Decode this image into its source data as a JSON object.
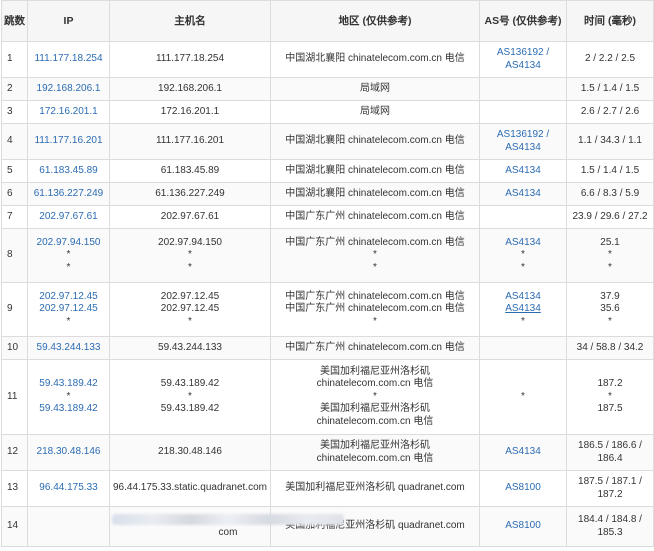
{
  "headers": {
    "hop": "跳数",
    "ip": "IP",
    "hostname": "主机名",
    "region": "地区 (仅供参考)",
    "asn": "AS号 (仅供参考)",
    "time": "时间 (毫秒)"
  },
  "rows": [
    {
      "hop": "1",
      "ip": [
        "111.177.18.254"
      ],
      "host": [
        "111.177.18.254"
      ],
      "region": [
        "中国湖北襄阳 chinatelecom.com.cn 电信"
      ],
      "asn": [
        "AS136192 /",
        "AS4134"
      ],
      "time": [
        "2 / 2.2 / 2.5"
      ]
    },
    {
      "hop": "2",
      "ip": [
        "192.168.206.1"
      ],
      "host": [
        "192.168.206.1"
      ],
      "region": [
        "局域网"
      ],
      "asn": [],
      "time": [
        "1.5 / 1.4 / 1.5"
      ]
    },
    {
      "hop": "3",
      "ip": [
        "172.16.201.1"
      ],
      "host": [
        "172.16.201.1"
      ],
      "region": [
        "局域网"
      ],
      "asn": [],
      "time": [
        "2.6 / 2.7 / 2.6"
      ]
    },
    {
      "hop": "4",
      "ip": [
        "111.177.16.201"
      ],
      "host": [
        "111.177.16.201"
      ],
      "region": [
        "中国湖北襄阳 chinatelecom.com.cn 电信"
      ],
      "asn": [
        "AS136192 /",
        "AS4134"
      ],
      "time": [
        "1.1 / 34.3 / 1.1"
      ]
    },
    {
      "hop": "5",
      "ip": [
        "61.183.45.89"
      ],
      "host": [
        "61.183.45.89"
      ],
      "region": [
        "中国湖北襄阳 chinatelecom.com.cn 电信"
      ],
      "asn": [
        "AS4134"
      ],
      "time": [
        "1.5 / 1.4 / 1.5"
      ]
    },
    {
      "hop": "6",
      "ip": [
        "61.136.227.249"
      ],
      "host": [
        "61.136.227.249"
      ],
      "region": [
        "中国湖北襄阳 chinatelecom.com.cn 电信"
      ],
      "asn": [
        "AS4134"
      ],
      "time": [
        "6.6 / 8.3 / 5.9"
      ]
    },
    {
      "hop": "7",
      "ip": [
        "202.97.67.61"
      ],
      "host": [
        "202.97.67.61"
      ],
      "region": [
        "中国广东广州 chinatelecom.com.cn 电信"
      ],
      "asn": [],
      "time": [
        "23.9 / 29.6 / 27.2"
      ]
    },
    {
      "hop": "8",
      "ip": [
        "202.97.94.150",
        "*",
        "*"
      ],
      "host": [
        "202.97.94.150",
        "*",
        "*"
      ],
      "region": [
        "中国广东广州 chinatelecom.com.cn 电信",
        "*",
        "*"
      ],
      "asn": [
        "AS4134",
        "*",
        "*"
      ],
      "time": [
        "25.1",
        "*",
        "*"
      ]
    },
    {
      "hop": "9",
      "ip": [
        "202.97.12.45",
        "202.97.12.45",
        "*"
      ],
      "host": [
        "202.97.12.45",
        "202.97.12.45",
        "*"
      ],
      "region": [
        "中国广东广州 chinatelecom.com.cn 电信",
        "中国广东广州 chinatelecom.com.cn 电信",
        "*"
      ],
      "asn": [
        "AS4134",
        "AS4134",
        "*"
      ],
      "time": [
        "37.9",
        "35.6",
        "*"
      ]
    },
    {
      "hop": "10",
      "ip": [
        "59.43.244.133"
      ],
      "host": [
        "59.43.244.133"
      ],
      "region": [
        "中国广东广州 chinatelecom.com.cn 电信"
      ],
      "asn": [],
      "time": [
        "34 / 58.8 / 34.2"
      ]
    },
    {
      "hop": "11",
      "ip": [
        "59.43.189.42",
        "*",
        "59.43.189.42"
      ],
      "host": [
        "59.43.189.42",
        "*",
        "59.43.189.42"
      ],
      "region": [
        "美国加利福尼亚州洛杉矶",
        "chinatelecom.com.cn 电信",
        "*",
        "美国加利福尼亚州洛杉矶",
        "chinatelecom.com.cn 电信"
      ],
      "asn": [
        "*"
      ],
      "time": [
        "187.2",
        "*",
        "187.5"
      ]
    },
    {
      "hop": "12",
      "ip": [
        "218.30.48.146"
      ],
      "host": [
        "218.30.48.146"
      ],
      "region": [
        "美国加利福尼亚州洛杉矶",
        "chinatelecom.com.cn 电信"
      ],
      "asn": [
        "AS4134"
      ],
      "time": [
        "186.5 / 186.6 /",
        "186.4"
      ]
    },
    {
      "hop": "13",
      "ip": [
        "96.44.175.33"
      ],
      "host": [
        "96.44.175.33.static.quadranet.com"
      ],
      "region": [
        "美国加利福尼亚州洛杉矶 quadranet.com"
      ],
      "asn": [
        "AS8100"
      ],
      "time": [
        "187.5 / 187.1 /",
        "187.2"
      ]
    },
    {
      "hop": "14",
      "ip": [],
      "host": [
        "com"
      ],
      "region": [
        "美国加利福尼亚州洛杉矶 quadranet.com"
      ],
      "asn": [
        "AS8100"
      ],
      "time": [
        "184.4 / 184.8 /",
        "185.3"
      ]
    }
  ],
  "colors": {
    "link": "#2b6cb3",
    "border": "#dcdcdc",
    "header_bg": "#f6f6f6",
    "text": "#333333"
  }
}
